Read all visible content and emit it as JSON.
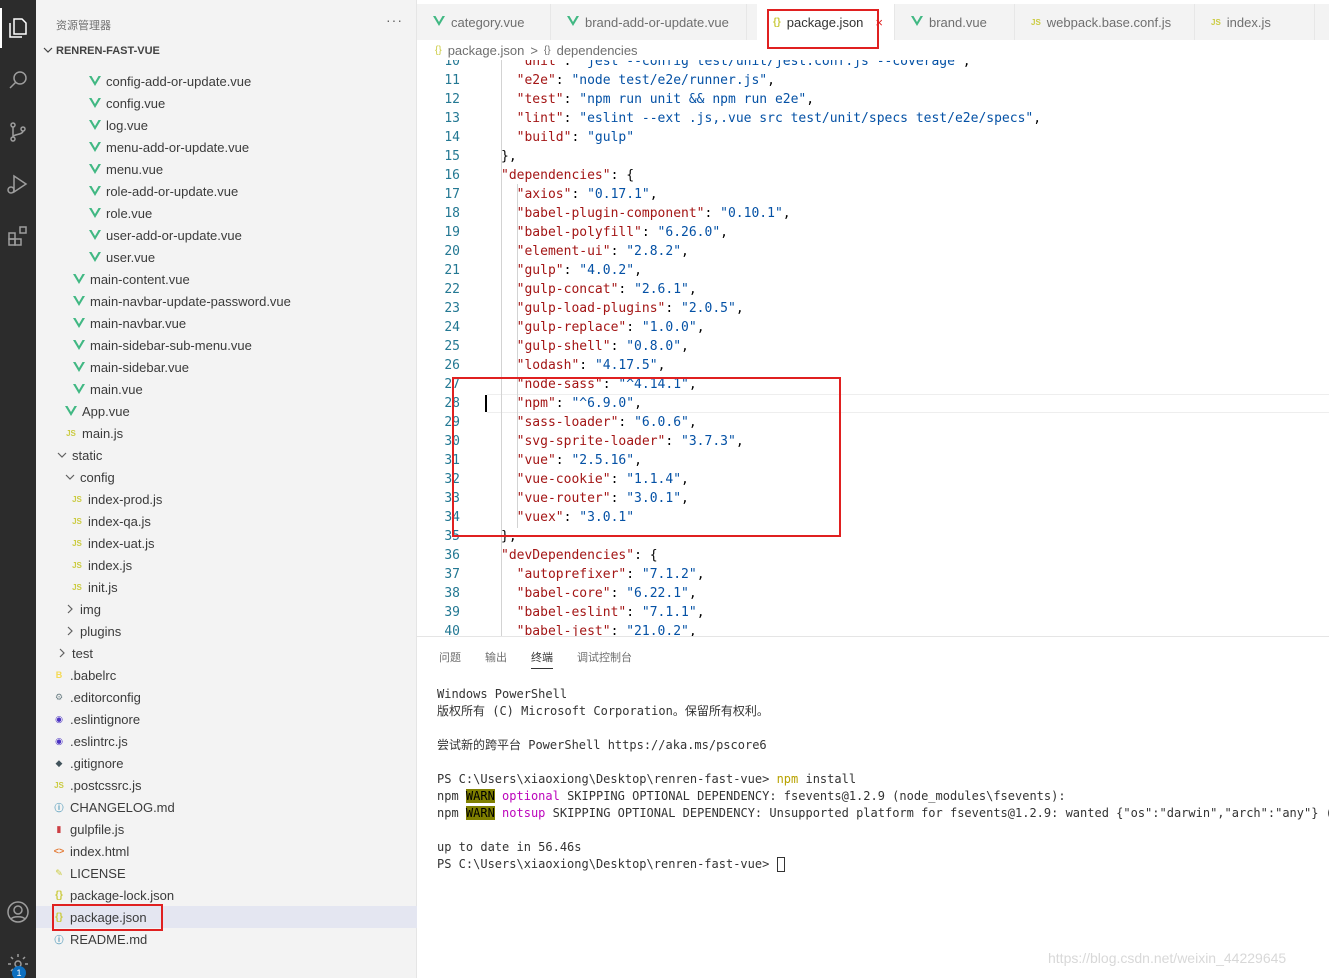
{
  "activity_bar": {
    "icons": [
      "files-icon",
      "search-icon",
      "source-control-icon",
      "run-debug-icon",
      "extensions-icon",
      "account-icon",
      "settings-icon"
    ],
    "settings_badge": "1"
  },
  "sidebar": {
    "title": "资源管理器",
    "more": "···",
    "section_title": "RENREN-FAST-VUE",
    "items": [
      {
        "label": "config-add-or-update.vue",
        "type": "vue"
      },
      {
        "label": "config.vue",
        "type": "vue"
      },
      {
        "label": "log.vue",
        "type": "vue"
      },
      {
        "label": "menu-add-or-update.vue",
        "type": "vue"
      },
      {
        "label": "menu.vue",
        "type": "vue"
      },
      {
        "label": "role-add-or-update.vue",
        "type": "vue"
      },
      {
        "label": "role.vue",
        "type": "vue"
      },
      {
        "label": "user-add-or-update.vue",
        "type": "vue"
      },
      {
        "label": "user.vue",
        "type": "vue"
      },
      {
        "label": "main-content.vue",
        "type": "vue"
      },
      {
        "label": "main-navbar-update-password.vue",
        "type": "vue"
      },
      {
        "label": "main-navbar.vue",
        "type": "vue"
      },
      {
        "label": "main-sidebar-sub-menu.vue",
        "type": "vue"
      },
      {
        "label": "main-sidebar.vue",
        "type": "vue"
      },
      {
        "label": "main.vue",
        "type": "vue"
      },
      {
        "label": "App.vue",
        "type": "vue"
      },
      {
        "label": "main.js",
        "type": "js"
      },
      {
        "label": "static",
        "type": "folder-open"
      },
      {
        "label": "config",
        "type": "folder-open"
      },
      {
        "label": "index-prod.js",
        "type": "js"
      },
      {
        "label": "index-qa.js",
        "type": "js"
      },
      {
        "label": "index-uat.js",
        "type": "js"
      },
      {
        "label": "index.js",
        "type": "js"
      },
      {
        "label": "init.js",
        "type": "js"
      },
      {
        "label": "img",
        "type": "folder"
      },
      {
        "label": "plugins",
        "type": "folder"
      },
      {
        "label": "test",
        "type": "folder"
      },
      {
        "label": ".babelrc",
        "type": "babel"
      },
      {
        "label": ".editorconfig",
        "type": "gear"
      },
      {
        "label": ".eslintignore",
        "type": "eslint"
      },
      {
        "label": ".eslintrc.js",
        "type": "eslint"
      },
      {
        "label": ".gitignore",
        "type": "git"
      },
      {
        "label": ".postcssrc.js",
        "type": "js"
      },
      {
        "label": "CHANGELOG.md",
        "type": "info"
      },
      {
        "label": "gulpfile.js",
        "type": "gulp"
      },
      {
        "label": "index.html",
        "type": "html"
      },
      {
        "label": "LICENSE",
        "type": "license"
      },
      {
        "label": "package-lock.json",
        "type": "json"
      },
      {
        "label": "package.json",
        "type": "json"
      },
      {
        "label": "README.md",
        "type": "info"
      }
    ]
  },
  "tabs": [
    {
      "label": "category.vue",
      "type": "vue"
    },
    {
      "label": "brand-add-or-update.vue",
      "type": "vue"
    },
    {
      "label": "package.json",
      "type": "json",
      "close": "×"
    },
    {
      "label": "brand.vue",
      "type": "vue"
    },
    {
      "label": "webpack.base.conf.js",
      "type": "js"
    },
    {
      "label": "index.js",
      "type": "js"
    }
  ],
  "breadcrumb": {
    "file": "package.json",
    "separator": ">",
    "symbol": "dependencies"
  },
  "editor": {
    "lines": [
      {
        "n": "10",
        "text": "    \"unit\": \"jest --config test/unit/jest.conf.js --coverage\","
      },
      {
        "n": "11",
        "text": "    \"e2e\": \"node test/e2e/runner.js\","
      },
      {
        "n": "12",
        "text": "    \"test\": \"npm run unit && npm run e2e\","
      },
      {
        "n": "13",
        "text": "    \"lint\": \"eslint --ext .js,.vue src test/unit/specs test/e2e/specs\","
      },
      {
        "n": "14",
        "text": "    \"build\": \"gulp\""
      },
      {
        "n": "15",
        "text": "  },"
      },
      {
        "n": "16",
        "text": "  \"dependencies\": {"
      },
      {
        "n": "17",
        "text": "    \"axios\": \"0.17.1\","
      },
      {
        "n": "18",
        "text": "    \"babel-plugin-component\": \"0.10.1\","
      },
      {
        "n": "19",
        "text": "    \"babel-polyfill\": \"6.26.0\","
      },
      {
        "n": "20",
        "text": "    \"element-ui\": \"2.8.2\","
      },
      {
        "n": "21",
        "text": "    \"gulp\": \"4.0.2\","
      },
      {
        "n": "22",
        "text": "    \"gulp-concat\": \"2.6.1\","
      },
      {
        "n": "23",
        "text": "    \"gulp-load-plugins\": \"2.0.5\","
      },
      {
        "n": "24",
        "text": "    \"gulp-replace\": \"1.0.0\","
      },
      {
        "n": "25",
        "text": "    \"gulp-shell\": \"0.8.0\","
      },
      {
        "n": "26",
        "text": "    \"lodash\": \"4.17.5\","
      },
      {
        "n": "27",
        "text": "    \"node-sass\": \"^4.14.1\","
      },
      {
        "n": "28",
        "text": "    \"npm\": \"^6.9.0\","
      },
      {
        "n": "29",
        "text": "    \"sass-loader\": \"6.0.6\","
      },
      {
        "n": "30",
        "text": "    \"svg-sprite-loader\": \"3.7.3\","
      },
      {
        "n": "31",
        "text": "    \"vue\": \"2.5.16\","
      },
      {
        "n": "32",
        "text": "    \"vue-cookie\": \"1.1.4\","
      },
      {
        "n": "33",
        "text": "    \"vue-router\": \"3.0.1\","
      },
      {
        "n": "34",
        "text": "    \"vuex\": \"3.0.1\""
      },
      {
        "n": "35",
        "text": "  },"
      },
      {
        "n": "36",
        "text": "  \"devDependencies\": {"
      },
      {
        "n": "37",
        "text": "    \"autoprefixer\": \"7.1.2\","
      },
      {
        "n": "38",
        "text": "    \"babel-core\": \"6.22.1\","
      },
      {
        "n": "39",
        "text": "    \"babel-eslint\": \"7.1.1\","
      },
      {
        "n": "40",
        "text": "    \"babel-jest\": \"21.0.2\","
      }
    ]
  },
  "panel": {
    "tabs": [
      "问题",
      "输出",
      "终端",
      "调试控制台"
    ],
    "active_tab": "终端",
    "terminal": {
      "l1": "Windows PowerShell",
      "l2": "版权所有 (C) Microsoft Corporation。保留所有权利。",
      "l3": "尝试新的跨平台 PowerShell https://aka.ms/pscore6",
      "l4_prompt": "PS C:\\Users\\xiaoxiong\\Desktop\\renren-fast-vue> ",
      "l4_cmd": "npm",
      "l4_arg": " install",
      "l5_npm": "npm ",
      "l5_warn": "WARN",
      "l5_tag": "optional",
      "l5_msg": " SKIPPING OPTIONAL DEPENDENCY: fsevents@1.2.9 (node_modules\\fsevents):",
      "l6_npm": "npm ",
      "l6_warn": "WARN",
      "l6_tag": "notsup",
      "l6_msg": " SKIPPING OPTIONAL DEPENDENCY: Unsupported platform for fsevents@1.2.9: wanted {\"os\":\"darwin\",\"arch\":\"any\"} (curr",
      "l7": "up to date in 56.46s",
      "l8_prompt": "PS C:\\Users\\xiaoxiong\\Desktop\\renren-fast-vue> "
    }
  },
  "watermark": "https://blog.csdn.net/weixin_44229645"
}
